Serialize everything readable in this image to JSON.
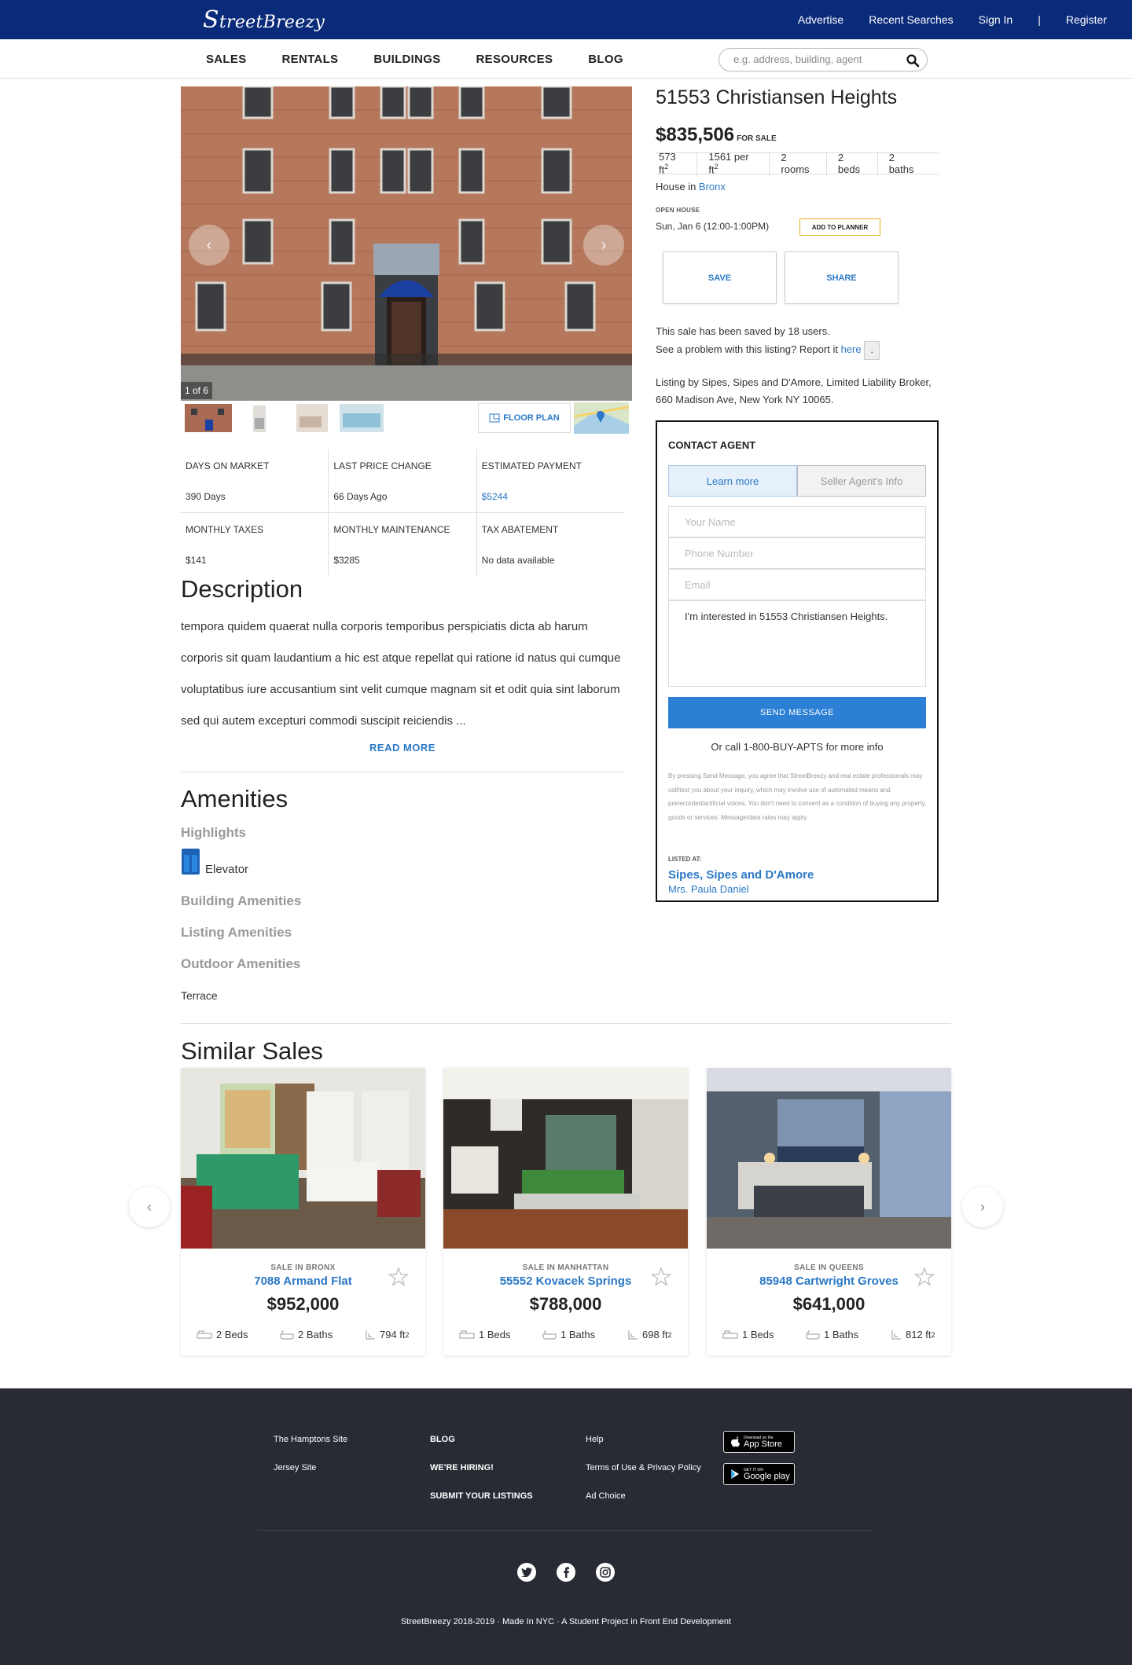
{
  "header": {
    "logo": "StreetBreezy",
    "links": [
      "Advertise",
      "Recent Searches",
      "Sign In",
      "Register"
    ],
    "separator": "|"
  },
  "nav": {
    "items": [
      "SALES",
      "RENTALS",
      "BUILDINGS",
      "RESOURCES",
      "BLOG"
    ],
    "search_placeholder": "e.g. address, building, agent"
  },
  "gallery": {
    "counter": "1 of 6",
    "floor_plan": "FLOOR PLAN"
  },
  "stats": [
    {
      "label": "DAYS ON MARKET",
      "value": "390 Days"
    },
    {
      "label": "LAST PRICE CHANGE",
      "value": "66 Days Ago"
    },
    {
      "label": "ESTIMATED PAYMENT",
      "value": "$5244"
    },
    {
      "label": "MONTHLY TAXES",
      "value": "$141"
    },
    {
      "label": "MONTHLY MAINTENANCE",
      "value": "$3285"
    },
    {
      "label": "TAX ABATEMENT",
      "value": "No data available"
    }
  ],
  "description": {
    "heading": "Description",
    "text": "tempora quidem quaerat nulla corporis temporibus perspiciatis dicta ab harum corporis sit quam laudantium a hic est atque repellat qui ratione id natus qui cumque voluptatibus iure accusantium sint velit cumque magnam sit et odit quia sint laborum sed qui autem excepturi commodi suscipit reiciendis ...",
    "read_more": "READ MORE"
  },
  "amenities": {
    "heading": "Amenities",
    "highlights": "Highlights",
    "elevator": "Elevator",
    "building": "Building Amenities",
    "listing": "Listing Amenities",
    "outdoor": "Outdoor Amenities",
    "terrace": "Terrace"
  },
  "listing": {
    "title": "51553 Christiansen Heights",
    "price": "$835,506",
    "price_tag": "FOR SALE",
    "sqft": "573 ft",
    "per_ft": "1561 per ft",
    "sup": "2",
    "rooms": "2 rooms",
    "beds": "2 beds",
    "baths": "2 baths",
    "house_in": "House in ",
    "borough": "Bronx",
    "open_house_label": "OPEN HOUSE",
    "open_house_time": "Sun, Jan 6 (12:00-1:00PM)",
    "add_to_planner": "ADD TO PLANNER",
    "save": "SAVE",
    "share": "SHARE",
    "saved_text": "This sale has been saved by 18 users.",
    "problem_text": "See a problem with this listing? Report it ",
    "here": "here",
    "dot": ".",
    "listing_by": "Listing by Sipes, Sipes and D'Amore, Limited Liability Broker, 660 Madison Ave, New York NY 10065."
  },
  "contact": {
    "title": "CONTACT AGENT",
    "tab_learn": "Learn more",
    "tab_seller": "Seller Agent's Info",
    "name_placeholder": "Your Name",
    "phone_placeholder": "Phone Number",
    "email_placeholder": "Email",
    "message": "I'm interested in 51553 Christiansen Heights.",
    "send": "SEND MESSAGE",
    "call": "Or call 1-800-BUY-APTS for more info",
    "legal": "By pressing Send Message, you agree that StreetBreezy and real estate professionals may call/text you about your inquiry, which may involve use of automated means and prerecorded/artificial voices. You don't need to consent as a condition of buying any property, goods or services. Message/data rates may apply.",
    "listed_at": "LISTED AT:",
    "broker": "Sipes, Sipes and D'Amore",
    "agent": "Mrs. Paula Daniel"
  },
  "similar": {
    "heading": "Similar Sales",
    "cards": [
      {
        "area": "SALE IN BRONX",
        "address": "7088 Armand Flat",
        "price": "$952,000",
        "beds": "2 Beds",
        "baths": "2 Baths",
        "sqft": "794 ft",
        "sup": "2"
      },
      {
        "area": "SALE IN MANHATTAN",
        "address": "55552 Kovacek Springs",
        "price": "$788,000",
        "beds": "1 Beds",
        "baths": "1 Baths",
        "sqft": "698 ft",
        "sup": "2"
      },
      {
        "area": "SALE IN QUEENS",
        "address": "85948 Cartwright Groves",
        "price": "$641,000",
        "beds": "1 Beds",
        "baths": "1 Baths",
        "sqft": "812 ft",
        "sup": "2"
      }
    ]
  },
  "footer": {
    "col1": [
      "The Hamptons Site",
      "Jersey Site"
    ],
    "col2": [
      "BLOG",
      "WE'RE HIRING!",
      "SUBMIT YOUR LISTINGS"
    ],
    "col3": [
      "Help",
      "Terms of Use & Privacy Policy",
      "Ad Choice"
    ],
    "appstore_small": "Download on the",
    "appstore_big": "App Store",
    "play_small": "GET IT ON",
    "play_big": "Google play",
    "copyright": "StreetBreezy 2018-2019 · Made In NYC · A Student Project in Front End Development"
  }
}
